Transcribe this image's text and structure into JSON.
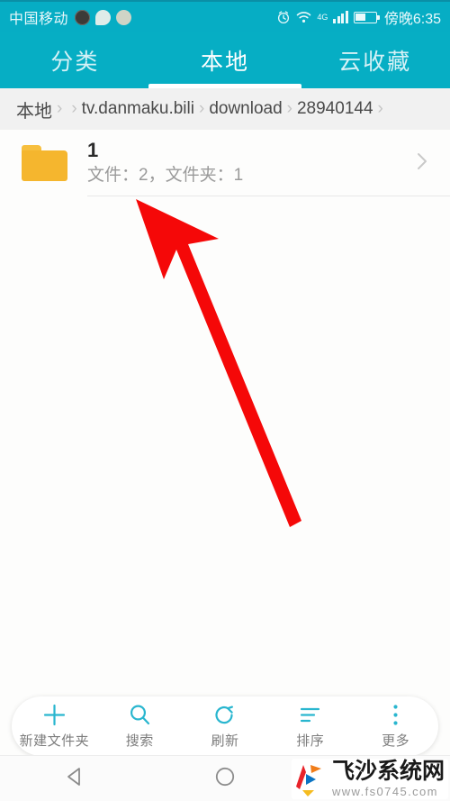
{
  "status_bar": {
    "carrier": "中国移动",
    "notification_icons": [
      "notification-dark-icon",
      "message-bubble-icon",
      "app-badge-icon"
    ],
    "alarm_icon": "alarm-clock-icon",
    "wifi_icon": "wifi-icon",
    "network_label": "4G",
    "signal_icon": "signal-bars-icon",
    "battery_icon": "battery-icon",
    "clock": "傍晚6:35"
  },
  "tabs": [
    {
      "label": "分类",
      "active": false,
      "name": "tab-categories"
    },
    {
      "label": "本地",
      "active": true,
      "name": "tab-local"
    },
    {
      "label": "云收藏",
      "active": false,
      "name": "tab-cloud-favorites"
    }
  ],
  "breadcrumb": {
    "separator": "›",
    "items": [
      {
        "label": "本地",
        "cjk": true
      },
      {
        "label": "tv.danmaku.bili",
        "cjk": false
      },
      {
        "label": "download",
        "cjk": false
      },
      {
        "label": "28940144",
        "cjk": false
      }
    ]
  },
  "file_list": {
    "rows": [
      {
        "icon": "folder-icon",
        "name": "1",
        "meta": "文件：2，文件夹：1",
        "chevron": "chevron-right-icon"
      }
    ]
  },
  "annotation": {
    "arrow_color": "#f50808",
    "type": "red-arrow-pointing-up-left"
  },
  "bottom_toolbar": {
    "buttons": [
      {
        "icon": "plus-icon",
        "label": "新建文件夹"
      },
      {
        "icon": "search-icon",
        "label": "搜索"
      },
      {
        "icon": "refresh-icon",
        "label": "刷新"
      },
      {
        "icon": "sort-icon",
        "label": "排序"
      },
      {
        "icon": "more-vertical-icon",
        "label": "更多"
      }
    ]
  },
  "nav_bar": {
    "back_icon": "back-triangle-icon",
    "home_icon": "home-circle-icon"
  },
  "watermark": {
    "logo": "feisha-logo-icon",
    "title": "飞沙系统网",
    "url": "www.fs0745.com"
  },
  "colors": {
    "accent_teal": "#06aec4",
    "status_teal": "#06adc4",
    "folder_yellow": "#f5b62e",
    "arrow_red": "#f50808",
    "breadcrumb_bg": "#f1f1f1",
    "content_bg": "#fdfdfc"
  }
}
